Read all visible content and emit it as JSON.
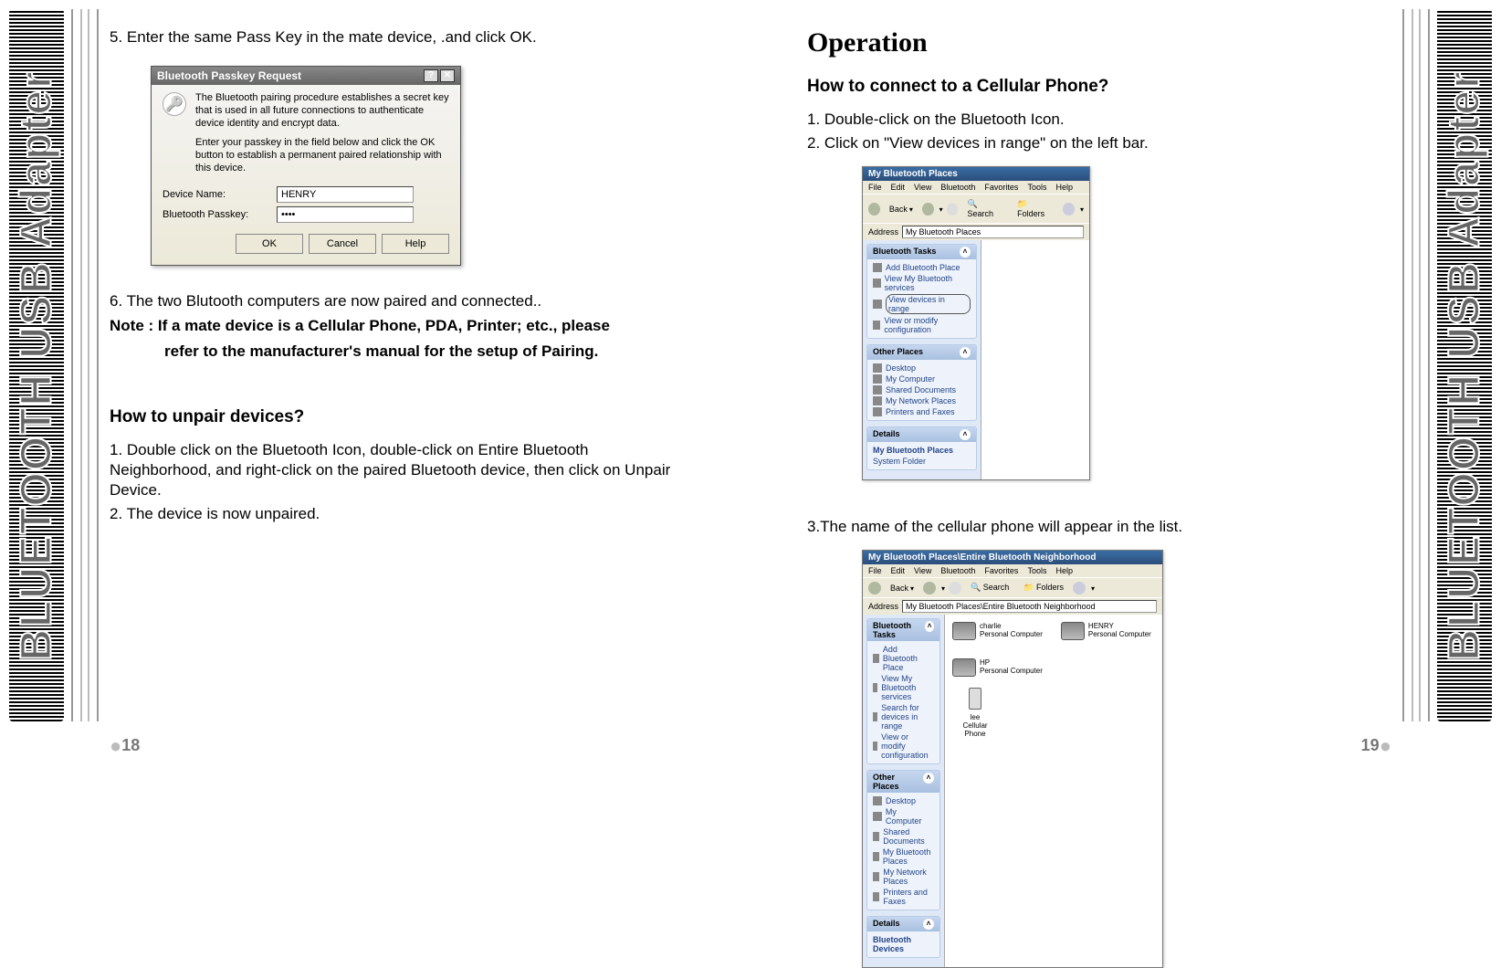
{
  "left_tab": "BLUETOOTH USB Adapter",
  "right_tab": "BLUETOOTH USB Adapter",
  "page_left_num": "18",
  "page_right_num": "19",
  "left": {
    "step5": "5.  Enter the same Pass Key in the mate device, .and click OK.",
    "step6": "6. The two Blutooth computers are now paired and connected..",
    "note_line1": "Note : If a mate device is a Cellular Phone, PDA, Printer; etc., please",
    "note_line2": "refer to the manufacturer's manual for the setup of Pairing.",
    "unpair_head": "How to unpair devices?",
    "unpair_1": "1.  Double click on the Bluetooth Icon, double-click on Entire Bluetooth Neighborhood, and right-click on the paired Bluetooth device, then click on Unpair Device.",
    "unpair_2": "2. The device is now unpaired."
  },
  "right": {
    "op_title": "Operation",
    "cell_head": "How to connect to a Cellular Phone?",
    "c1": "1.  Double-click on the Bluetooth Icon.",
    "c2": "2.  Click on \"View devices in range\" on the left bar.",
    "c3": "3.The name of the cellular phone will appear in the list."
  },
  "dlg": {
    "title": "Bluetooth Passkey Request",
    "p1": "The Bluetooth pairing procedure establishes a secret key that is used in all future connections to authenticate device identity and encrypt data.",
    "p2": "Enter your passkey in the field below and click the OK button to establish a permanent paired relationship with this device.",
    "dn_label": "Device Name:",
    "dn_value": "HENRY",
    "pk_label": "Bluetooth Passkey:",
    "pk_value": "••••",
    "ok": "OK",
    "cancel": "Cancel",
    "help": "Help",
    "q": "?",
    "x": "✕"
  },
  "fig1": {
    "title": "My Bluetooth Places",
    "menu": [
      "File",
      "Edit",
      "View",
      "Bluetooth",
      "Favorites",
      "Tools",
      "Help"
    ],
    "tb_back": "Back",
    "tb_search": "Search",
    "tb_folders": "Folders",
    "addr_label": "Address",
    "addr_value": "My Bluetooth Places",
    "panel1_h": "Bluetooth Tasks",
    "panel1_items": [
      "Add Bluetooth Place",
      "View My Bluetooth services",
      "View devices in range",
      "View or modify configuration"
    ],
    "panel2_h": "Other Places",
    "panel2_items": [
      "Desktop",
      "My Computer",
      "Shared Documents",
      "My Network Places",
      "Printers and Faxes"
    ],
    "panel3_h": "Details",
    "panel3_l1": "My Bluetooth Places",
    "panel3_l2": "System Folder"
  },
  "fig2": {
    "title": "My Bluetooth Places\\Entire Bluetooth Neighborhood",
    "menu": [
      "File",
      "Edit",
      "View",
      "Bluetooth",
      "Favorites",
      "Tools",
      "Help"
    ],
    "tb_back": "Back",
    "tb_search": "Search",
    "tb_folders": "Folders",
    "addr_label": "Address",
    "addr_value": "My Bluetooth Places\\Entire Bluetooth Neighborhood",
    "panel1_h": "Bluetooth Tasks",
    "panel1_items": [
      "Add Bluetooth Place",
      "View My Bluetooth services",
      "Search for devices in range",
      "View or modify configuration"
    ],
    "panel2_h": "Other Places",
    "panel2_items": [
      "Desktop",
      "My Computer",
      "Shared Documents",
      "My Bluetooth Places",
      "My Network Places",
      "Printers and Faxes"
    ],
    "panel3_h": "Details",
    "panel3_l1": "Bluetooth Devices",
    "dev1_name": "charlie",
    "dev1_sub": "Personal Computer",
    "dev2_name": "HENRY",
    "dev2_sub": "Personal Computer",
    "dev3_name": "HP",
    "dev3_sub": "Personal Computer",
    "dev4_name": "lee",
    "dev4_sub": "Cellular Phone"
  }
}
